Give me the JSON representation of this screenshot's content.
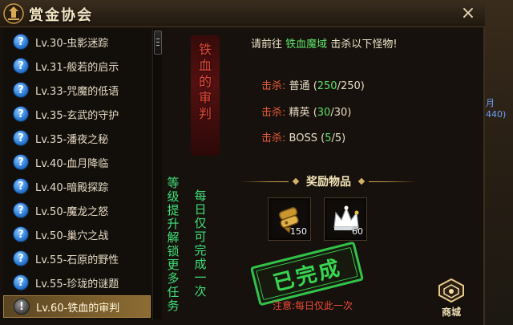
{
  "window": {
    "title": "赏金协会",
    "close_glyph": "×"
  },
  "quests": [
    {
      "label": "Lv.30-虫影迷踪",
      "icon": "question-icon",
      "status": "available"
    },
    {
      "label": "Lv.31-般若的启示",
      "icon": "question-icon",
      "status": "available"
    },
    {
      "label": "Lv.33-咒魔的低语",
      "icon": "question-icon",
      "status": "available"
    },
    {
      "label": "Lv.35-玄武的守护",
      "icon": "question-icon",
      "status": "available"
    },
    {
      "label": "Lv.35-潘夜之秘",
      "icon": "question-icon",
      "status": "available"
    },
    {
      "label": "Lv.40-血月降临",
      "icon": "question-icon",
      "status": "available"
    },
    {
      "label": "Lv.40-暗殿探踪",
      "icon": "question-icon",
      "status": "available"
    },
    {
      "label": "Lv.50-魔龙之怒",
      "icon": "question-icon",
      "status": "available"
    },
    {
      "label": "Lv.50-巢穴之战",
      "icon": "question-icon",
      "status": "available"
    },
    {
      "label": "Lv.55-石原的野性",
      "icon": "question-icon",
      "status": "available"
    },
    {
      "label": "Lv.55-珍珑的谜题",
      "icon": "question-icon",
      "status": "available"
    },
    {
      "label": "Lv.60-铁血的审判",
      "icon": "exclamation-icon",
      "status": "selected"
    }
  ],
  "quest_icon_glyphs": {
    "available": "?",
    "selected": "!"
  },
  "detail": {
    "quest_title": "铁血的审判",
    "unlock_hint": "等级提升解锁更多任务",
    "daily_hint": "每日仅可完成一次",
    "prompt_prefix": "请前往",
    "prompt_location": "铁血魔域",
    "prompt_suffix": "击杀以下怪物!",
    "kills": [
      {
        "label": "击杀:",
        "type": "普通",
        "current": "250",
        "total": "/250"
      },
      {
        "label": "击杀:",
        "type": "精英",
        "current": "30",
        "total": "/30"
      },
      {
        "label": "击杀:",
        "type": "BOSS",
        "current": "5",
        "total": "/5"
      }
    ],
    "paren_open": "(",
    "paren_close": ")",
    "reward_title": "奖励物品",
    "rewards": [
      {
        "icon": "gold-scroll-icon",
        "count": "150"
      },
      {
        "icon": "crown-icon",
        "count": "60"
      }
    ],
    "stamp_text": "已完成",
    "note": "注意:每日仅此一次"
  },
  "shop": {
    "label": "商城",
    "icon": "shop-emblem-icon"
  },
  "world": {
    "fragment": "月440)"
  },
  "colors": {
    "accent_green": "#5ee068",
    "alert_red": "#e85a3a",
    "selected_row": "#7a5e2c"
  }
}
